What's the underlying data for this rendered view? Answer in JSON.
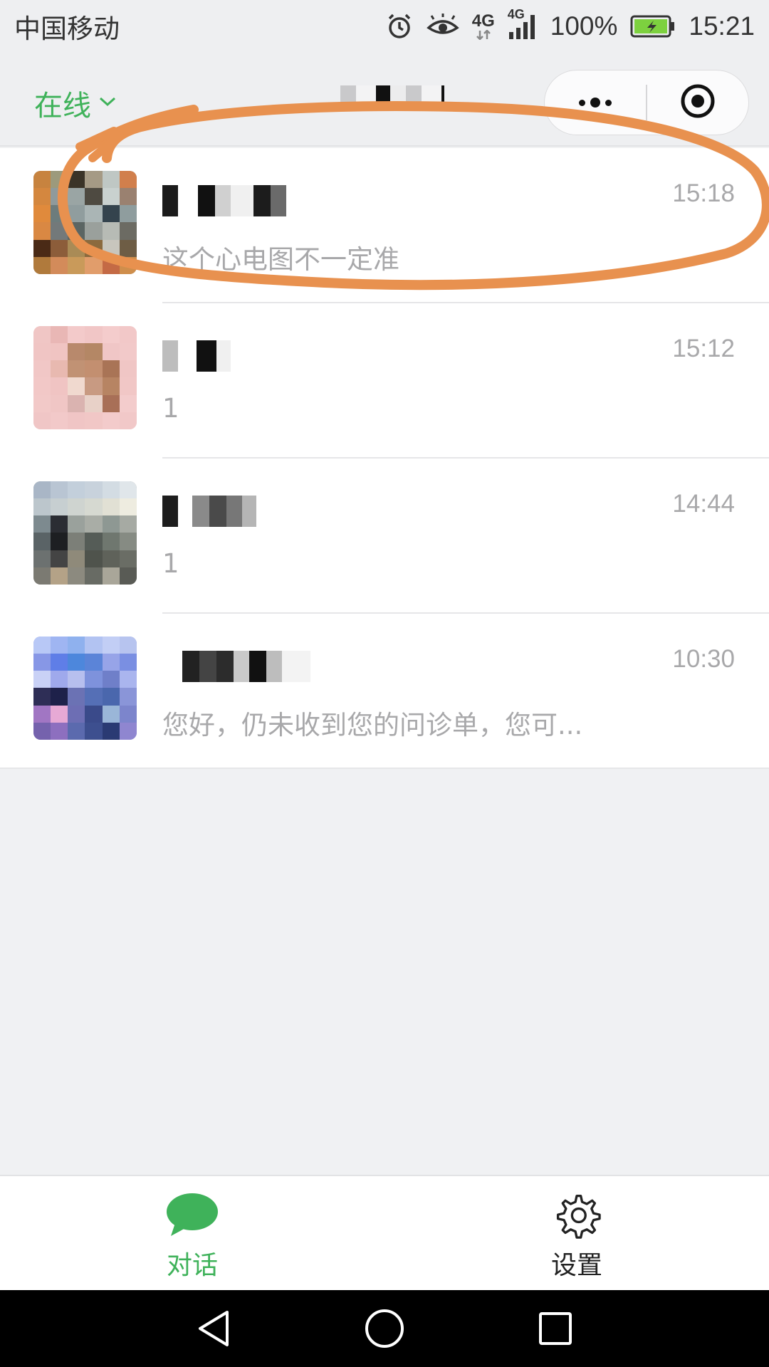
{
  "status_bar": {
    "carrier": "中国移动",
    "network_main": "4G",
    "network_secondary": "4G",
    "battery_percent": "100%",
    "time": "15:21",
    "icons": [
      "alarm-icon",
      "eye-icon",
      "signal-icon",
      "battery-charging-icon"
    ]
  },
  "header": {
    "status_label": "在线",
    "status_icon": "chevron-down-icon",
    "capsule_icons": [
      "more-dots-icon",
      "close-target-icon"
    ]
  },
  "chats": [
    {
      "time": "15:18",
      "preview": "这个心电图不一定准"
    },
    {
      "time": "15:12",
      "preview": "1"
    },
    {
      "time": "14:44",
      "preview": "1"
    },
    {
      "time": "10:30",
      "preview": "您好，仍未收到您的问诊单，您可..."
    }
  ],
  "tabs": [
    {
      "label": "对话",
      "icon": "chat-bubble-icon",
      "active": true
    },
    {
      "label": "设置",
      "icon": "gear-icon",
      "active": false
    }
  ],
  "colors": {
    "accent": "#3fb25a",
    "annotation": "#e8914f",
    "muted_text": "#a8a8aa",
    "background": "#f0f1f3"
  }
}
